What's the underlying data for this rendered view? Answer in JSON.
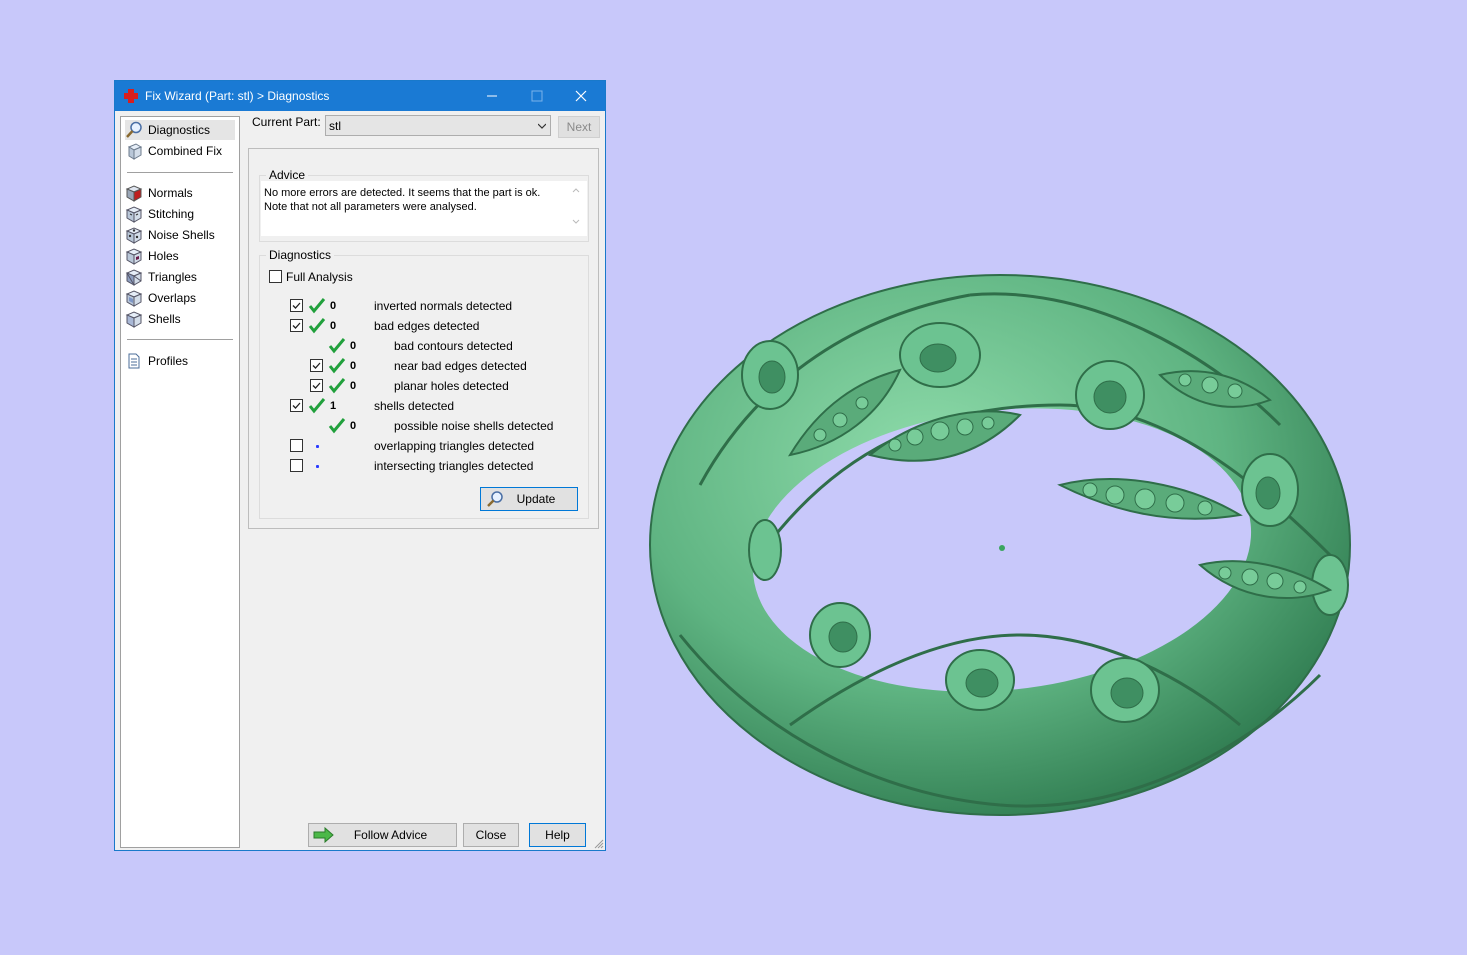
{
  "window": {
    "title": "Fix Wizard (Part: stl) > Diagnostics"
  },
  "sidebar": {
    "items": [
      {
        "label": "Diagnostics",
        "icon": "magnifier-icon"
      },
      {
        "label": "Combined Fix",
        "icon": "cube-icon"
      },
      {
        "label": "Normals",
        "icon": "normals-cube-icon"
      },
      {
        "label": "Stitching",
        "icon": "stitching-cube-icon"
      },
      {
        "label": "Noise Shells",
        "icon": "noise-shells-icon"
      },
      {
        "label": "Holes",
        "icon": "holes-cube-icon"
      },
      {
        "label": "Triangles",
        "icon": "triangles-cube-icon"
      },
      {
        "label": "Overlaps",
        "icon": "overlaps-cube-icon"
      },
      {
        "label": "Shells",
        "icon": "shells-cube-icon"
      },
      {
        "label": "Profiles",
        "icon": "document-icon"
      }
    ]
  },
  "current_part": {
    "label": "Current Part:",
    "value": "stl"
  },
  "next_label": "Next",
  "advice": {
    "title": "Advice",
    "lines": [
      "No more errors are detected. It seems that the part is ok.",
      "Note that not all parameters were analysed."
    ]
  },
  "diagnostics": {
    "title": "Diagnostics",
    "full_analysis_label": "Full Analysis",
    "full_analysis_checked": false,
    "rows": [
      {
        "text": "inverted normals detected",
        "count": "0",
        "checked": true
      },
      {
        "text": "bad edges detected",
        "count": "0",
        "checked": true
      },
      {
        "text": "bad contours detected",
        "count": "0"
      },
      {
        "text": "near bad edges detected",
        "count": "0",
        "checked": true
      },
      {
        "text": "planar holes detected",
        "count": "0",
        "checked": true
      },
      {
        "text": "shells detected",
        "count": "1",
        "checked": true
      },
      {
        "text": "possible noise shells detected",
        "count": "0"
      },
      {
        "text": "overlapping triangles detected",
        "checked": false
      },
      {
        "text": "intersecting triangles detected",
        "checked": false
      }
    ],
    "update_label": "Update"
  },
  "footer": {
    "follow_advice_label": "Follow Advice",
    "close_label": "Close",
    "help_label": "Help"
  },
  "colors": {
    "titlebar": "#1a7ad4",
    "background": "#c8c8fa",
    "model": "#5fb482",
    "check": "#21a03c"
  }
}
